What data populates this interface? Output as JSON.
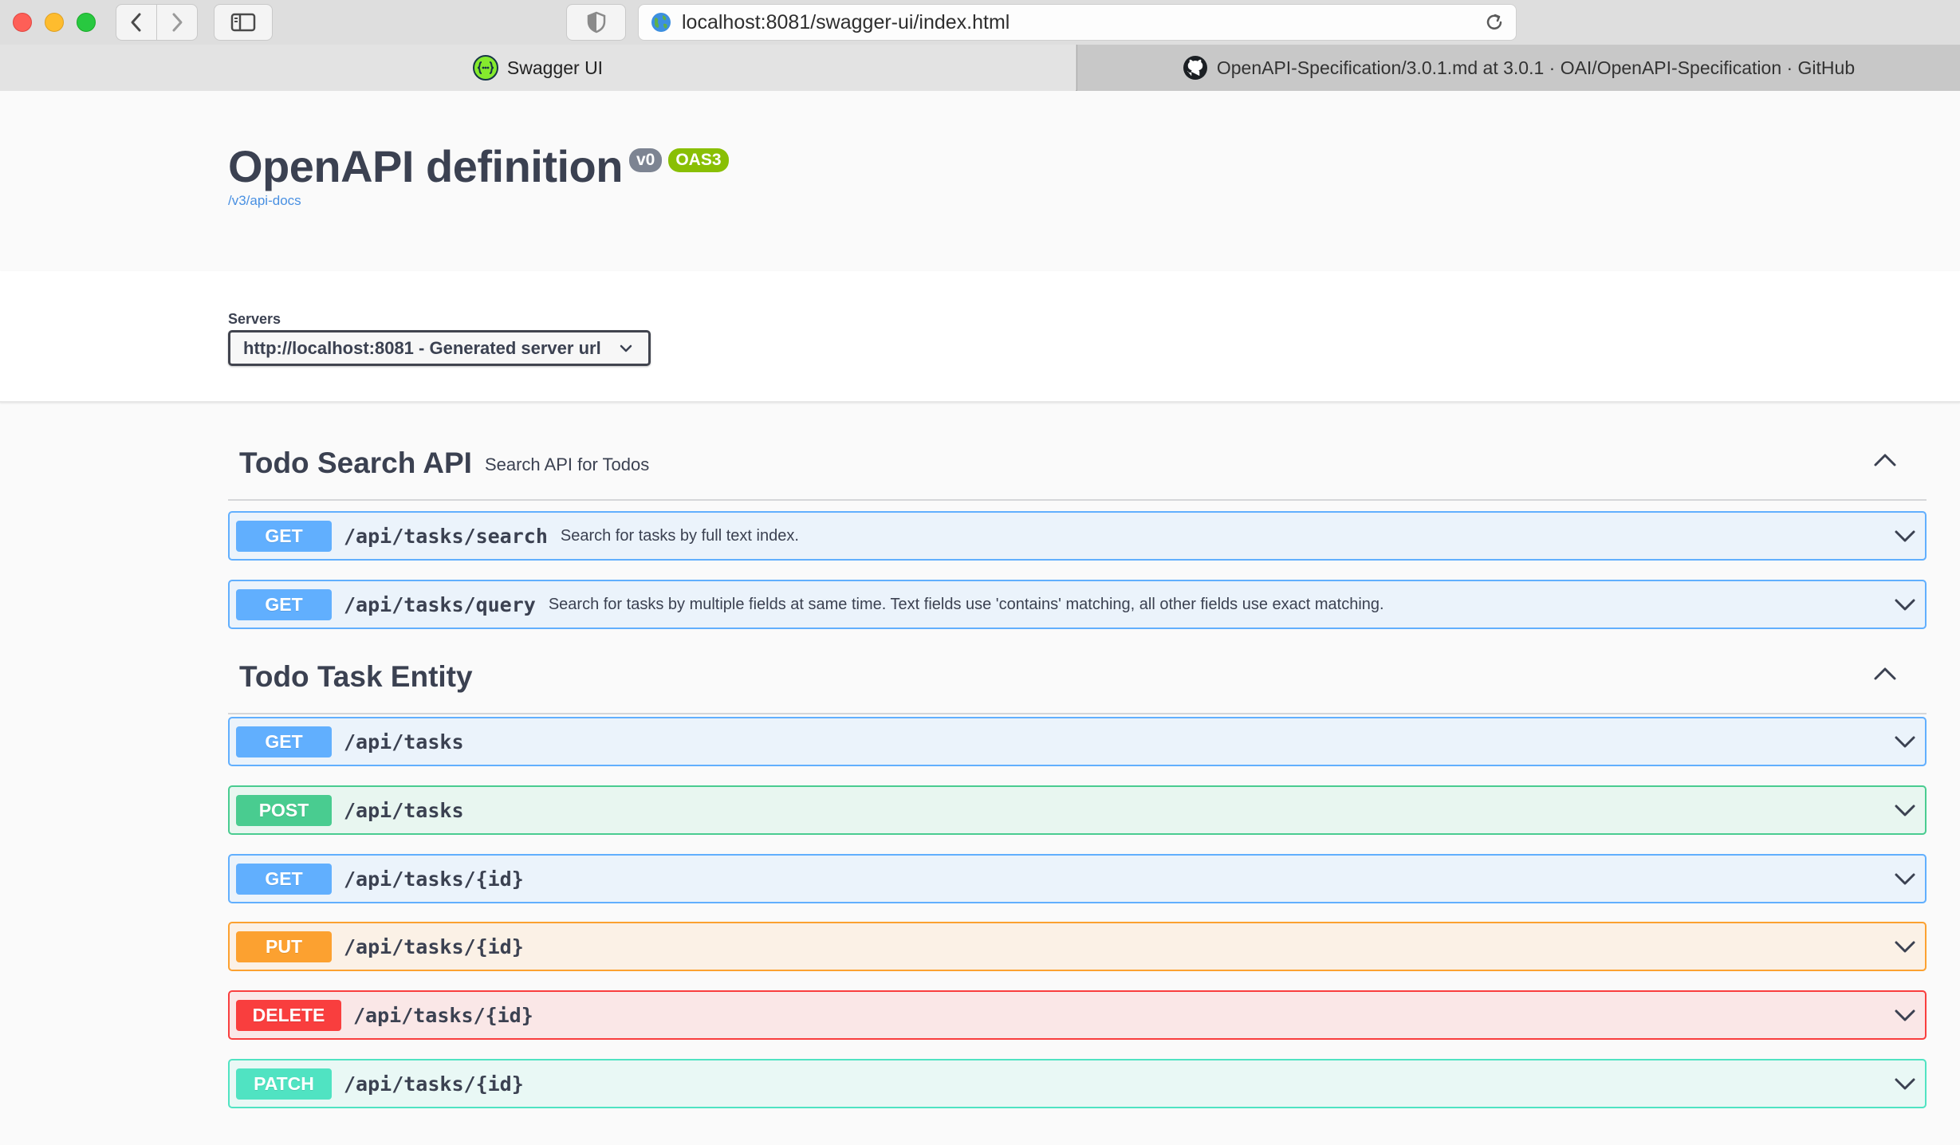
{
  "browser": {
    "url": "localhost:8081/swagger-ui/index.html",
    "tabs": [
      {
        "label": "Swagger UI",
        "active": true,
        "icon": "swagger-icon"
      },
      {
        "label": "OpenAPI-Specification/3.0.1.md at 3.0.1 · OAI/OpenAPI-Specification · GitHub",
        "active": false,
        "icon": "github-icon"
      }
    ]
  },
  "info": {
    "title": "OpenAPI definition",
    "version_badge": "v0",
    "oas_badge": "OAS3",
    "doc_link": "/v3/api-docs"
  },
  "servers": {
    "label": "Servers",
    "selected": "http://localhost:8081 - Generated server url"
  },
  "tags": [
    {
      "name": "Todo Search API",
      "description": "Search API for Todos",
      "operations": [
        {
          "method": "GET",
          "path": "/api/tasks/search",
          "summary": "Search for tasks by full text index."
        },
        {
          "method": "GET",
          "path": "/api/tasks/query",
          "summary": "Search for tasks by multiple fields at same time. Text fields use 'contains' matching, all other fields use exact matching."
        }
      ]
    },
    {
      "name": "Todo Task Entity",
      "description": "",
      "operations": [
        {
          "method": "GET",
          "path": "/api/tasks",
          "summary": ""
        },
        {
          "method": "POST",
          "path": "/api/tasks",
          "summary": ""
        },
        {
          "method": "GET",
          "path": "/api/tasks/{id}",
          "summary": ""
        },
        {
          "method": "PUT",
          "path": "/api/tasks/{id}",
          "summary": ""
        },
        {
          "method": "DELETE",
          "path": "/api/tasks/{id}",
          "summary": ""
        },
        {
          "method": "PATCH",
          "path": "/api/tasks/{id}",
          "summary": ""
        }
      ]
    }
  ],
  "colors": {
    "get": "#61affe",
    "post": "#49cc90",
    "put": "#fca130",
    "delete": "#f93e3e",
    "patch": "#50e3c2",
    "link": "#4990e2",
    "oas_badge": "#89bf04"
  }
}
